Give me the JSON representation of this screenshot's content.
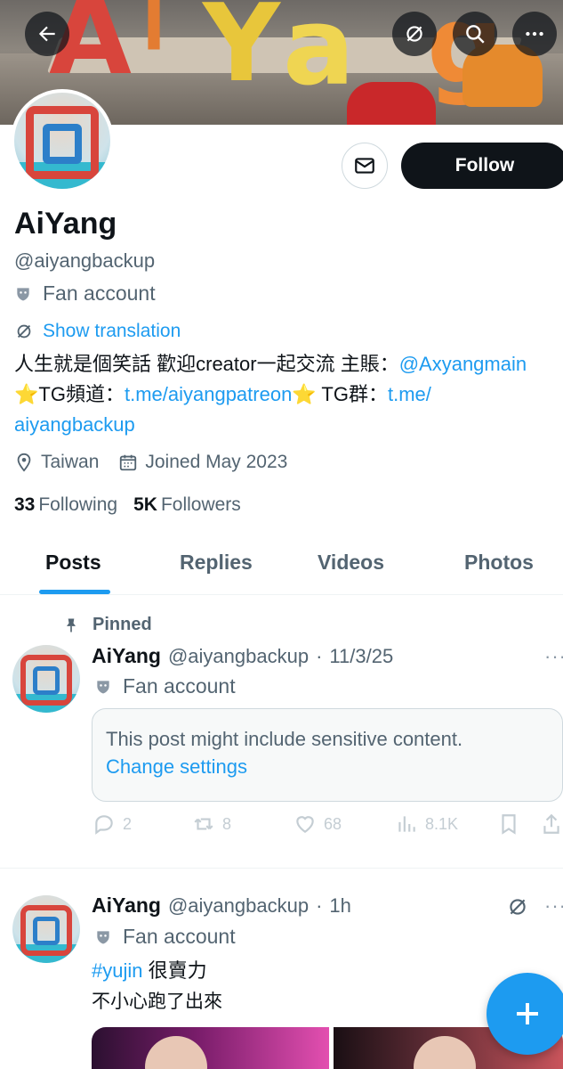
{
  "profile": {
    "name": "AiYang",
    "handle": "@aiyangbackup",
    "account_type": "Fan account",
    "follow_label": "Follow",
    "show_translation": "Show translation",
    "bio": {
      "line1_text": "人生就是個笑話 歡迎creator一起交流 主賬：",
      "line1_link": "@Axyangmain",
      "line2_prefix": "TG頻道：",
      "line2_link": "t.me/aiyangpatreon",
      "line2_mid": " TG群：",
      "line2_link2": "t.me/",
      "line3_link": "aiyangbackup"
    },
    "location": "Taiwan",
    "joined": "Joined May 2023",
    "following_count": "33",
    "following_label": "Following",
    "followers_count": "5K",
    "followers_label": "Followers"
  },
  "tabs": [
    "Posts",
    "Replies",
    "Videos",
    "Photos"
  ],
  "active_tab": "Posts",
  "posts": [
    {
      "pinned_label": "Pinned",
      "name": "AiYang",
      "handle": "@aiyangbackup",
      "sep": "·",
      "time": "11/3/25",
      "account_type": "Fan account",
      "sensitive_text": "This post might include sensitive content.",
      "change_settings": "Change settings",
      "replies": "2",
      "reposts": "8",
      "likes": "68",
      "views": "8.1K"
    },
    {
      "name": "AiYang",
      "handle": "@aiyangbackup",
      "sep": "·",
      "time": "1h",
      "account_type": "Fan account",
      "hashtag": "#yujin",
      "text_after_tag": " 很賣力",
      "text_line2": "不小心跑了出來"
    }
  ],
  "icons": {
    "back": "arrow-left-icon",
    "translate": "translate-icon",
    "search": "search-icon",
    "more": "more-icon",
    "message": "envelope-icon",
    "compose": "plus-icon"
  },
  "colors": {
    "accent": "#1d9bf0",
    "text_primary": "#0f1419",
    "text_secondary": "#536471",
    "follow_bg": "#0f1419"
  }
}
